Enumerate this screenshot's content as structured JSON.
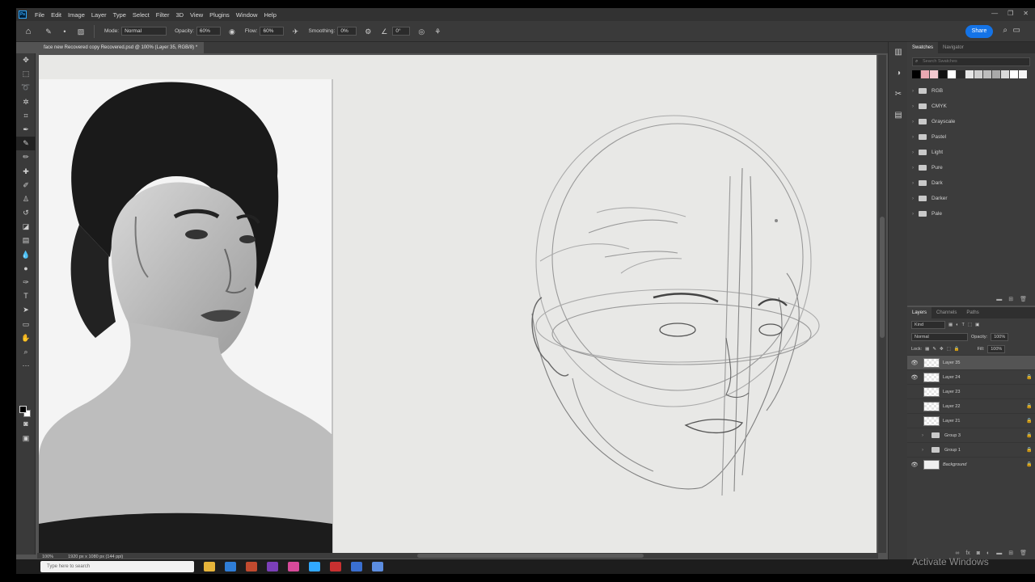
{
  "app": {
    "logo": "Ps"
  },
  "menu": [
    "File",
    "Edit",
    "Image",
    "Layer",
    "Type",
    "Select",
    "Filter",
    "3D",
    "View",
    "Plugins",
    "Window",
    "Help"
  ],
  "options": {
    "mode_label": "Mode:",
    "mode_value": "Normal",
    "opacity_label": "Opacity:",
    "opacity_value": "60%",
    "flow_label": "Flow:",
    "flow_value": "60%",
    "smoothing_label": "Smoothing:",
    "smoothing_value": "0%",
    "angle_value": "0°",
    "share_label": "Share"
  },
  "document": {
    "tab_title": "face new Recovered copy Recovered.psd @ 100% (Layer 35, RGB/8) *",
    "zoom": "100%",
    "dimensions": "1920 px x 1080 px (144 ppi)"
  },
  "swatches_panel": {
    "tabs": [
      "Swatches",
      "Navigator"
    ],
    "search_placeholder": "Search Swatches",
    "colors": [
      "#000000",
      "#e9a8b2",
      "#f2c9cf",
      "#111111",
      "#ffffff",
      "#2a2a2a",
      "#e6e6e6",
      "#cfcfcf",
      "#bdbdbd",
      "#a9a9a9",
      "#d9d9d9",
      "#ffffff",
      "#f4f4f4"
    ],
    "folders": [
      "RGB",
      "CMYK",
      "Grayscale",
      "Pastel",
      "Light",
      "Pure",
      "Dark",
      "Darker",
      "Pale"
    ]
  },
  "layers_panel": {
    "tabs": [
      "Layers",
      "Channels",
      "Paths"
    ],
    "filter_value": "Kind",
    "blend_value": "Normal",
    "opacity_label": "Opacity:",
    "opacity_value": "100%",
    "lock_label": "Lock:",
    "fill_label": "Fill:",
    "fill_value": "100%",
    "layers": [
      {
        "name": "Layer 35",
        "visible": true,
        "type": "layer",
        "locked": false,
        "selected": true
      },
      {
        "name": "Layer 24",
        "visible": true,
        "type": "layer",
        "locked": true,
        "selected": false
      },
      {
        "name": "Layer 23",
        "visible": false,
        "type": "layer",
        "locked": false,
        "selected": false
      },
      {
        "name": "Layer 22",
        "visible": false,
        "type": "layer",
        "locked": true,
        "selected": false
      },
      {
        "name": "Layer 21",
        "visible": false,
        "type": "layer",
        "locked": true,
        "selected": false
      },
      {
        "name": "Group 3",
        "visible": false,
        "type": "group",
        "locked": true,
        "selected": false
      },
      {
        "name": "Group 1",
        "visible": false,
        "type": "group",
        "locked": true,
        "selected": false
      },
      {
        "name": "Background",
        "visible": true,
        "type": "background",
        "locked": true,
        "selected": false
      }
    ]
  },
  "taskbar": {
    "search_placeholder": "Type here to search"
  },
  "watermark": "Activate Windows"
}
